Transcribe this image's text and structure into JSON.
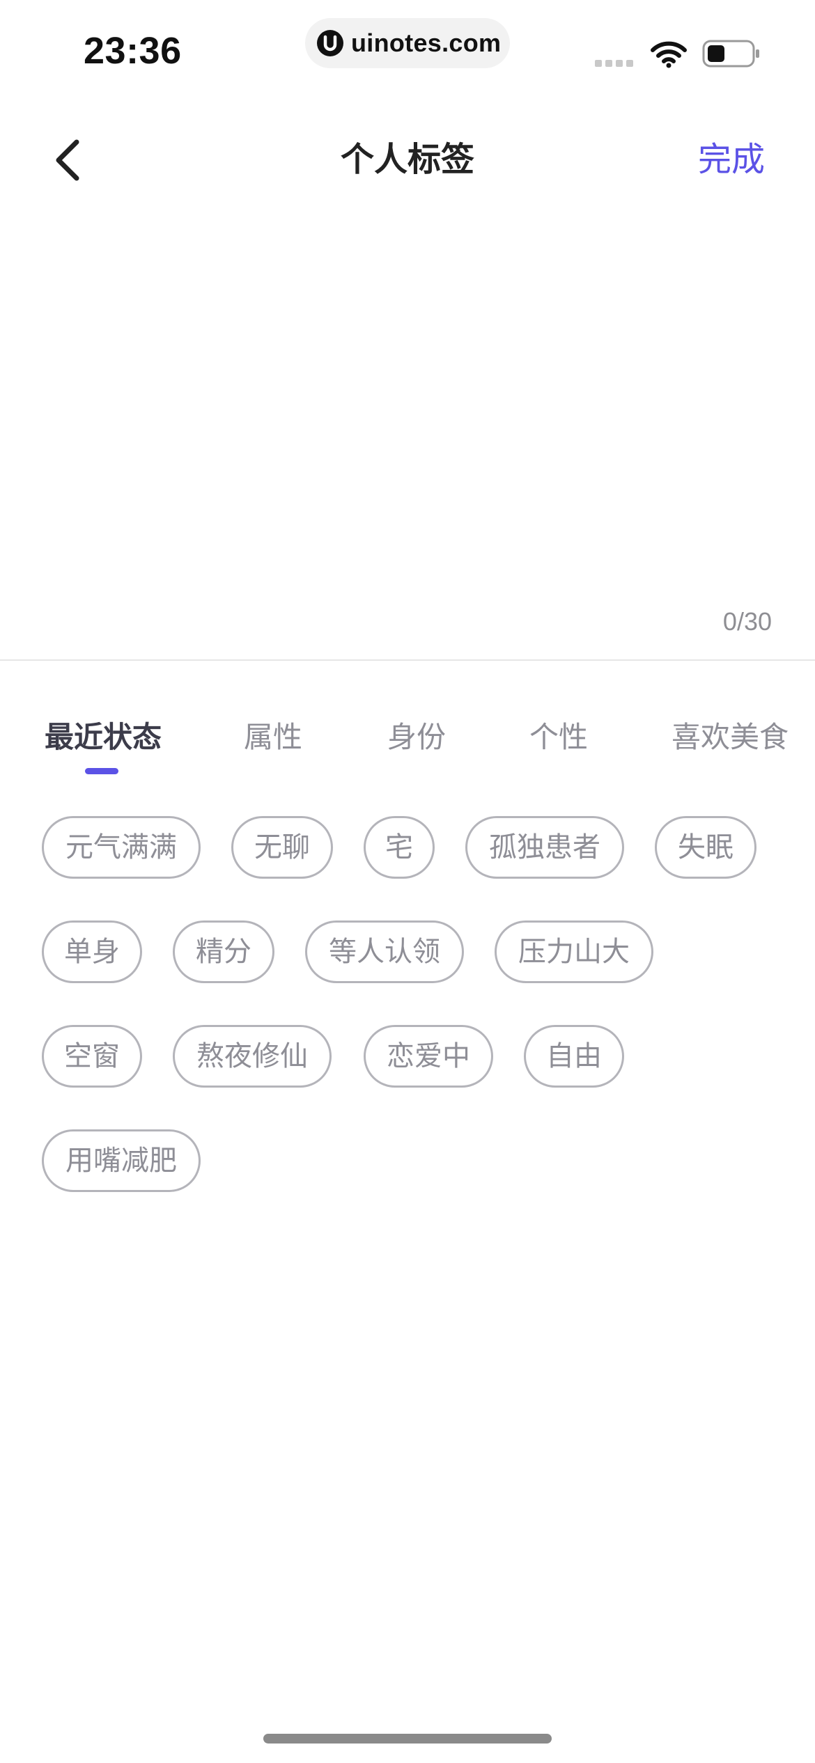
{
  "status_bar": {
    "time": "23:36",
    "url": "uinotes.com",
    "icons": [
      "signal-icon",
      "wifi-icon",
      "battery-icon"
    ]
  },
  "nav": {
    "back_icon": "chevron-left-icon",
    "title": "个人标签",
    "done_label": "完成"
  },
  "editor": {
    "value": "",
    "char_count": "0/30"
  },
  "tabs": [
    {
      "label": "最近状态",
      "active": true
    },
    {
      "label": "属性",
      "active": false
    },
    {
      "label": "身份",
      "active": false
    },
    {
      "label": "个性",
      "active": false
    },
    {
      "label": "喜欢美食",
      "active": false
    }
  ],
  "tags": [
    "元气满满",
    "无聊",
    "宅",
    "孤独患者",
    "失眠",
    "单身",
    "精分",
    "等人认领",
    "压力山大",
    "空窗",
    "熬夜修仙",
    "恋爱中",
    "自由",
    "用嘴减肥"
  ],
  "colors": {
    "accent": "#5b52e6",
    "chip_border": "#b4b4ba",
    "chip_text": "#8e8e96",
    "active_tab_text": "#3c3c4a"
  }
}
